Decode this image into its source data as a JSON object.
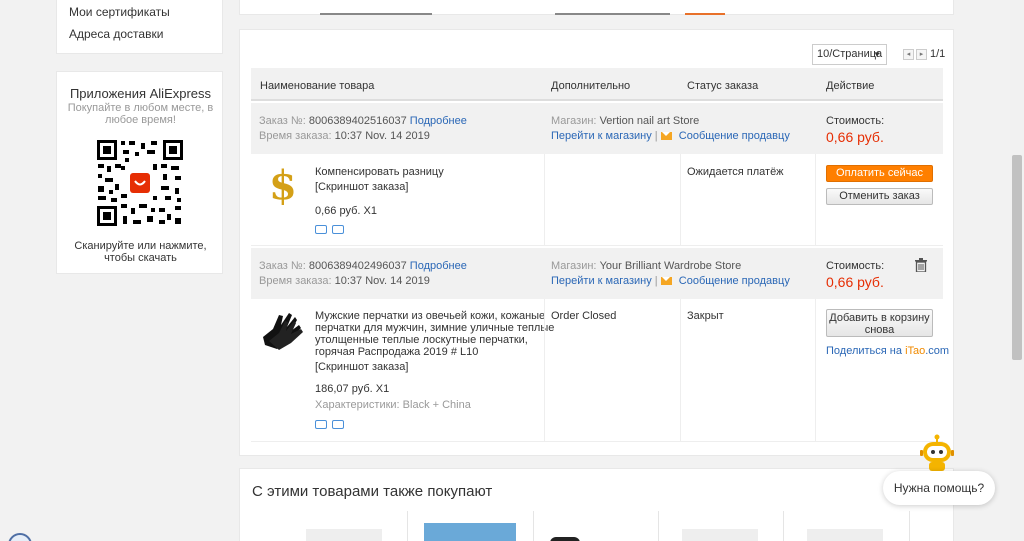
{
  "sidebar": {
    "links": [
      "Мои сертификаты",
      "Адреса доставки"
    ],
    "apps": {
      "title": "Приложения AliExpress",
      "subtitle_line1": "Покупайте в любом месте, в",
      "subtitle_line2": "любое время!",
      "scan_line1": "Сканируйте или нажмите,",
      "scan_line2": "чтобы скачать"
    }
  },
  "pager": {
    "per_page": "10/Страница",
    "pages": "1/1"
  },
  "table": {
    "headers": [
      "Наименование товара",
      "Дополнительно",
      "Статус заказа",
      "Действие"
    ]
  },
  "orders": [
    {
      "order_label": "Заказ №:",
      "order_no": "8006389402516037",
      "details": "Подробнее",
      "time_label": "Время заказа:",
      "time": "10:37 Nov. 14 2019",
      "store_label": "Магазин:",
      "store": "Vertion nail art Store",
      "go_store": "Перейти к магазину",
      "message": "Сообщение продавцу",
      "cost_label": "Стоимость:",
      "cost": "0,66 руб.",
      "item_title": "Компенсировать разницу",
      "snapshot": "[Скриншот заказа]",
      "item_price": "0,66 руб. X1",
      "extra": "",
      "status": "Ожидается платёж",
      "action1": "Оплатить сейчас",
      "action2": "Отменить заказ"
    },
    {
      "order_label": "Заказ №:",
      "order_no": "8006389402496037",
      "details": "Подробнее",
      "time_label": "Время заказа:",
      "time": "10:37 Nov. 14 2019",
      "store_label": "Магазин:",
      "store": "Your Brilliant Wardrobe Store",
      "go_store": "Перейти к магазину",
      "message": "Сообщение продавцу",
      "cost_label": "Стоимость:",
      "cost": "0,66 руб.",
      "item_title_lines": [
        "Мужские перчатки из овечьей кожи, кожаные",
        "перчатки для мужчин, зимние уличные теплые",
        "утолщенные теплые лоскутные перчатки,",
        "горячая Распродажа 2019 # L10"
      ],
      "snapshot": "[Скриншот заказа]",
      "item_price": "186,07 руб. X1",
      "characteristics": "Характеристики: Black + China",
      "extra": "Order Closed",
      "status": "Закрыт",
      "action1_line1": "Добавить в корзину",
      "action1_line2": "снова",
      "share_prefix": "Поделиться на",
      "share_brand": "iTao",
      "share_suffix": ".com"
    }
  ],
  "recommend": {
    "title": "С этими товарами также покупают"
  },
  "help": {
    "label": "Нужна помощь?"
  },
  "colors": {
    "accent": "#ff7f00",
    "price": "#e62e04",
    "link": "#2a67b6"
  }
}
